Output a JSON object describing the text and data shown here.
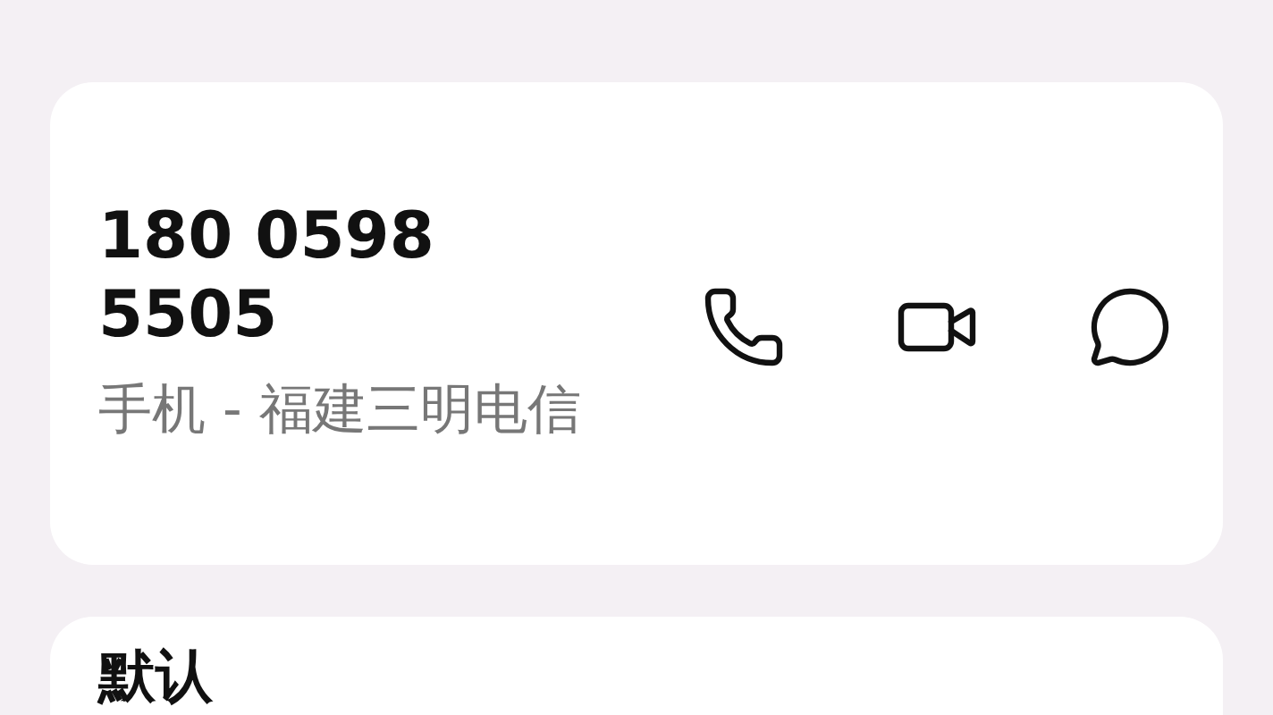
{
  "contact": {
    "number": "180 0598 5505",
    "description": "手机 - 福建三明电信",
    "actions": [
      {
        "kind": "call"
      },
      {
        "kind": "video"
      },
      {
        "kind": "message"
      }
    ]
  },
  "section": {
    "title": "默认"
  }
}
